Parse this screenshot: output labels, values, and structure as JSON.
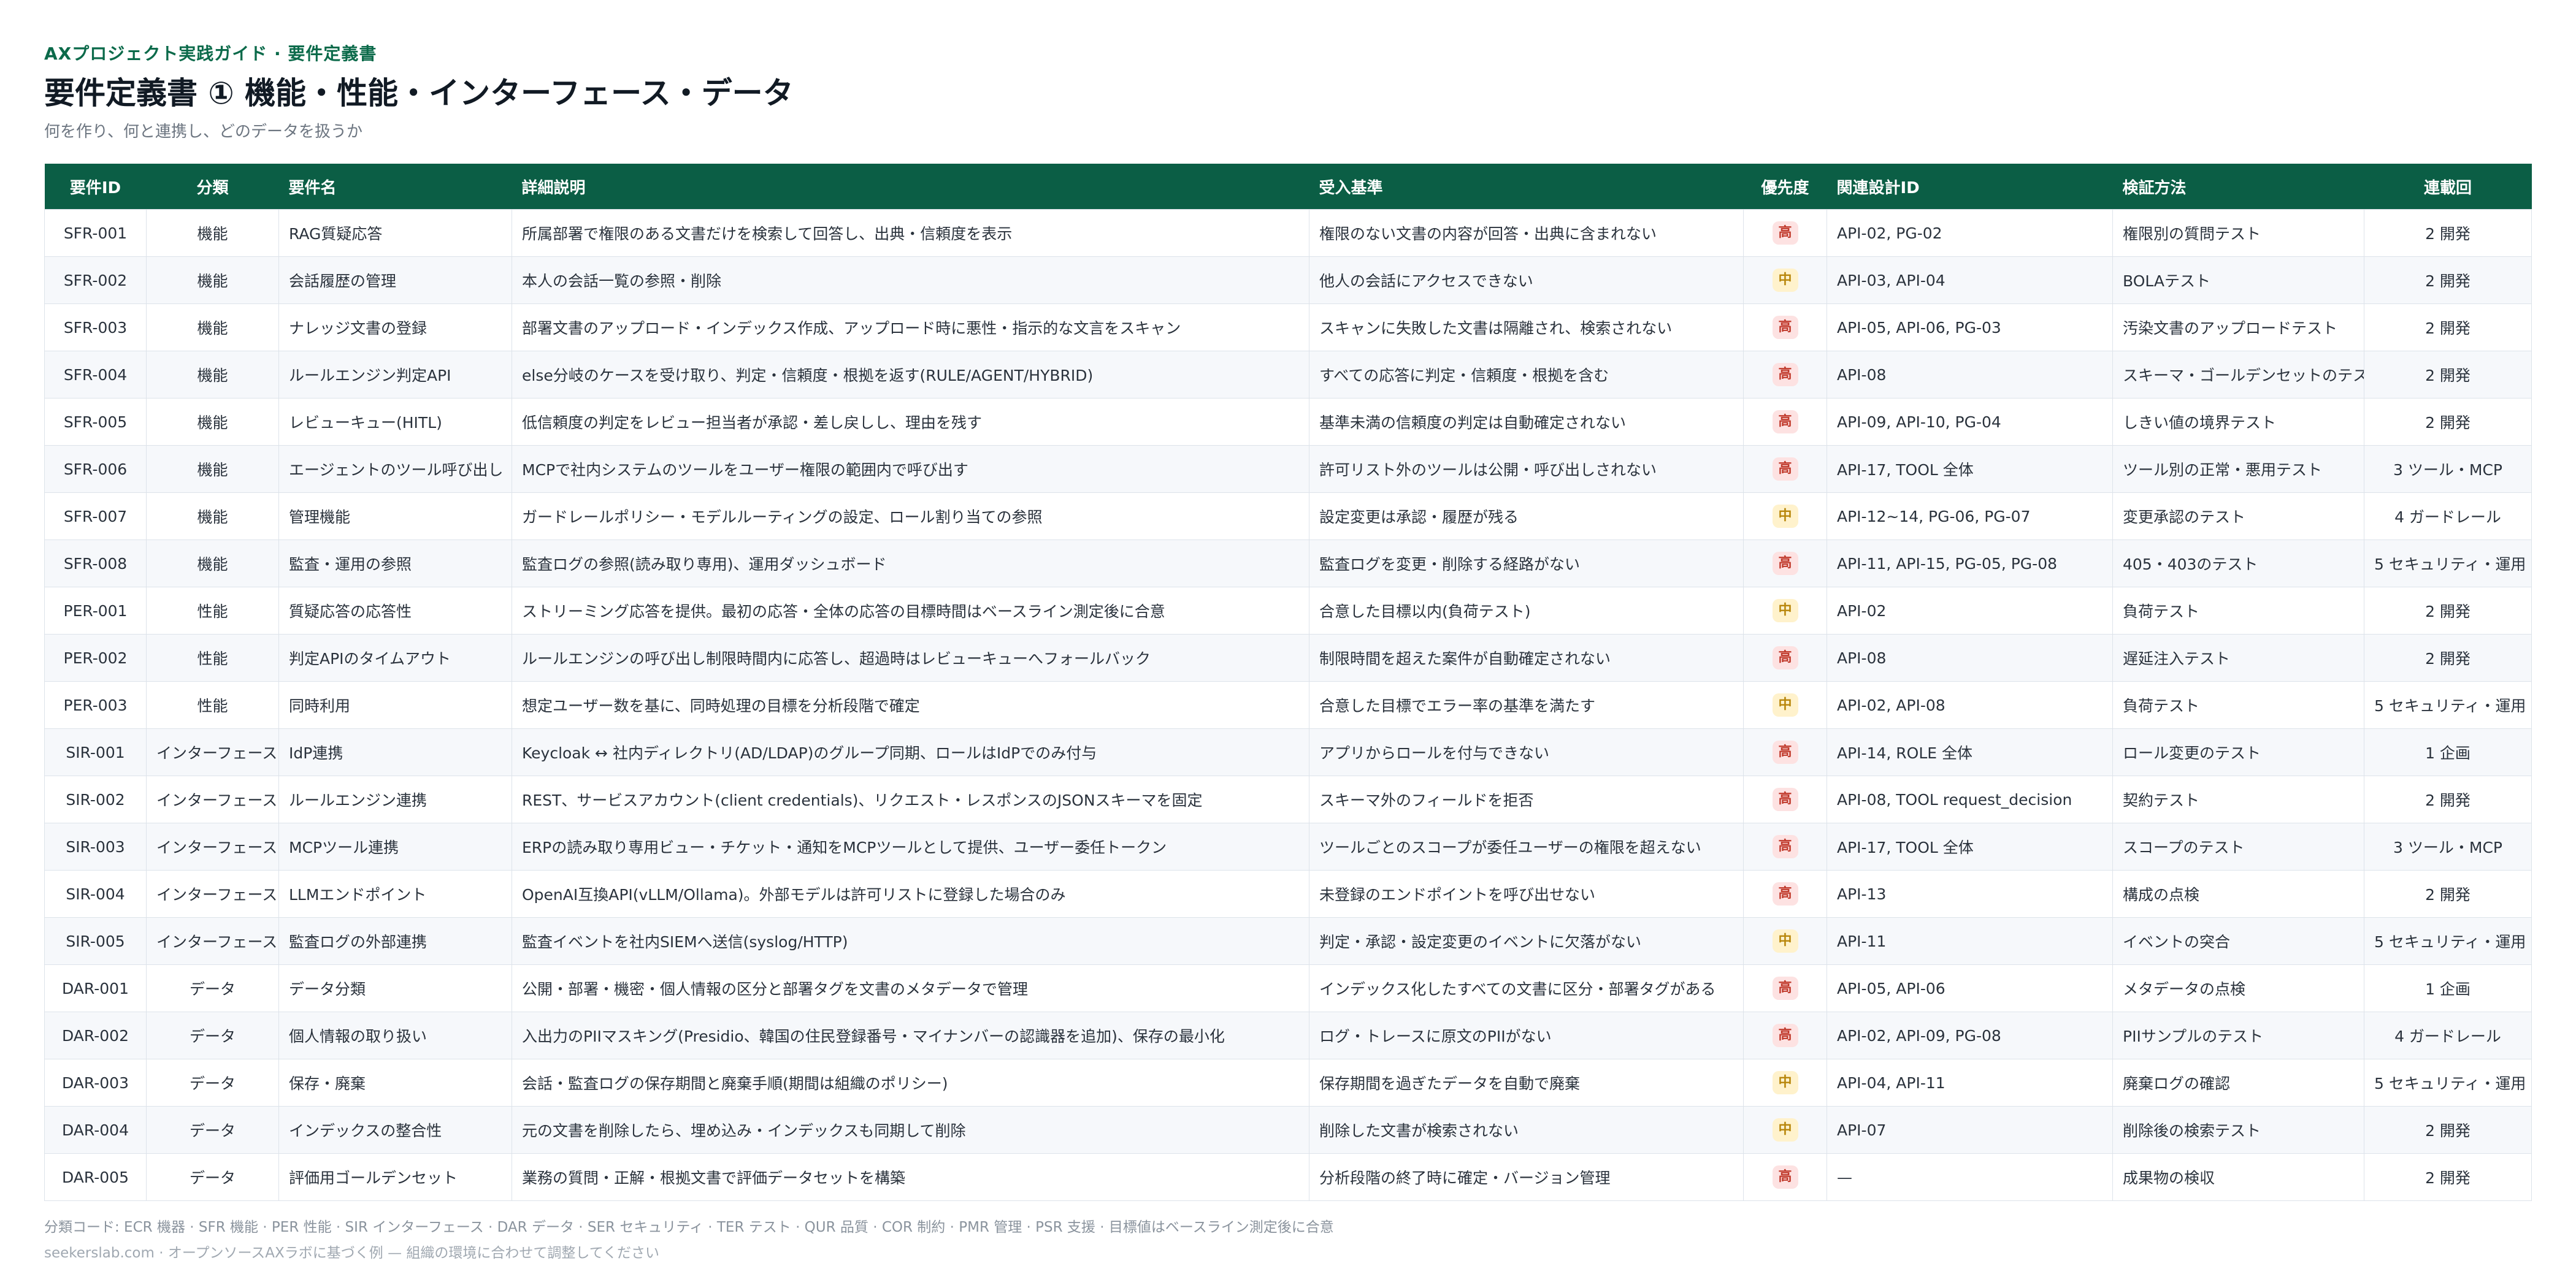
{
  "header": {
    "eyebrow": "AXプロジェクト実践ガイド · 要件定義書",
    "title": "要件定義書 ① 機能・性能・インターフェース・データ",
    "subtitle": "何を作り、何と連携し、どのデータを扱うか"
  },
  "table": {
    "columns": [
      "要件ID",
      "分類",
      "要件名",
      "詳細説明",
      "受入基準",
      "優先度",
      "関連設計ID",
      "検証方法",
      "連載回"
    ],
    "rows": [
      {
        "id": "SFR-001",
        "category": "機能",
        "name": "RAG質疑応答",
        "detail": "所属部署で権限のある文書だけを検索して回答し、出典・信頼度を表示",
        "acceptance": "権限のない文書の内容が回答・出典に含まれない",
        "priority": "高",
        "priority_level": "high",
        "design": "API-02, PG-02",
        "verify": "権限別の質問テスト",
        "episode": "2 開発"
      },
      {
        "id": "SFR-002",
        "category": "機能",
        "name": "会話履歴の管理",
        "detail": "本人の会話一覧の参照・削除",
        "acceptance": "他人の会話にアクセスできない",
        "priority": "中",
        "priority_level": "mid",
        "design": "API-03, API-04",
        "verify": "BOLAテスト",
        "episode": "2 開発"
      },
      {
        "id": "SFR-003",
        "category": "機能",
        "name": "ナレッジ文書の登録",
        "detail": "部署文書のアップロード・インデックス作成、アップロード時に悪性・指示的な文言をスキャン",
        "acceptance": "スキャンに失敗した文書は隔離され、検索されない",
        "priority": "高",
        "priority_level": "high",
        "design": "API-05, API-06, PG-03",
        "verify": "汚染文書のアップロードテスト",
        "episode": "2 開発"
      },
      {
        "id": "SFR-004",
        "category": "機能",
        "name": "ルールエンジン判定API",
        "detail": "else分岐のケースを受け取り、判定・信頼度・根拠を返す(RULE/AGENT/HYBRID)",
        "acceptance": "すべての応答に判定・信頼度・根拠を含む",
        "priority": "高",
        "priority_level": "high",
        "design": "API-08",
        "verify": "スキーマ・ゴールデンセットのテスト",
        "episode": "2 開発"
      },
      {
        "id": "SFR-005",
        "category": "機能",
        "name": "レビューキュー(HITL)",
        "detail": "低信頼度の判定をレビュー担当者が承認・差し戻しし、理由を残す",
        "acceptance": "基準未満の信頼度の判定は自動確定されない",
        "priority": "高",
        "priority_level": "high",
        "design": "API-09, API-10, PG-04",
        "verify": "しきい値の境界テスト",
        "episode": "2 開発"
      },
      {
        "id": "SFR-006",
        "category": "機能",
        "name": "エージェントのツール呼び出し",
        "detail": "MCPで社内システムのツールをユーザー権限の範囲内で呼び出す",
        "acceptance": "許可リスト外のツールは公開・呼び出しされない",
        "priority": "高",
        "priority_level": "high",
        "design": "API-17, TOOL 全体",
        "verify": "ツール別の正常・悪用テスト",
        "episode": "3 ツール・MCP"
      },
      {
        "id": "SFR-007",
        "category": "機能",
        "name": "管理機能",
        "detail": "ガードレールポリシー・モデルルーティングの設定、ロール割り当ての参照",
        "acceptance": "設定変更は承認・履歴が残る",
        "priority": "中",
        "priority_level": "mid",
        "design": "API-12~14, PG-06, PG-07",
        "verify": "変更承認のテスト",
        "episode": "4 ガードレール"
      },
      {
        "id": "SFR-008",
        "category": "機能",
        "name": "監査・運用の参照",
        "detail": "監査ログの参照(読み取り専用)、運用ダッシュボード",
        "acceptance": "監査ログを変更・削除する経路がない",
        "priority": "高",
        "priority_level": "high",
        "design": "API-11, API-15, PG-05, PG-08",
        "verify": "405・403のテスト",
        "episode": "5 セキュリティ・運用"
      },
      {
        "id": "PER-001",
        "category": "性能",
        "name": "質疑応答の応答性",
        "detail": "ストリーミング応答を提供。最初の応答・全体の応答の目標時間はベースライン測定後に合意",
        "acceptance": "合意した目標以内(負荷テスト)",
        "priority": "中",
        "priority_level": "mid",
        "design": "API-02",
        "verify": "負荷テスト",
        "episode": "2 開発"
      },
      {
        "id": "PER-002",
        "category": "性能",
        "name": "判定APIのタイムアウト",
        "detail": "ルールエンジンの呼び出し制限時間内に応答し、超過時はレビューキューへフォールバック",
        "acceptance": "制限時間を超えた案件が自動確定されない",
        "priority": "高",
        "priority_level": "high",
        "design": "API-08",
        "verify": "遅延注入テスト",
        "episode": "2 開発"
      },
      {
        "id": "PER-003",
        "category": "性能",
        "name": "同時利用",
        "detail": "想定ユーザー数を基に、同時処理の目標を分析段階で確定",
        "acceptance": "合意した目標でエラー率の基準を満たす",
        "priority": "中",
        "priority_level": "mid",
        "design": "API-02, API-08",
        "verify": "負荷テスト",
        "episode": "5 セキュリティ・運用"
      },
      {
        "id": "SIR-001",
        "category": "インターフェース",
        "name": "IdP連携",
        "detail": "Keycloak ↔ 社内ディレクトリ(AD/LDAP)のグループ同期、ロールはIdPでのみ付与",
        "acceptance": "アプリからロールを付与できない",
        "priority": "高",
        "priority_level": "high",
        "design": "API-14, ROLE 全体",
        "verify": "ロール変更のテスト",
        "episode": "1 企画"
      },
      {
        "id": "SIR-002",
        "category": "インターフェース",
        "name": "ルールエンジン連携",
        "detail": "REST、サービスアカウント(client credentials)、リクエスト・レスポンスのJSONスキーマを固定",
        "acceptance": "スキーマ外のフィールドを拒否",
        "priority": "高",
        "priority_level": "high",
        "design": "API-08, TOOL request_decision",
        "verify": "契約テスト",
        "episode": "2 開発"
      },
      {
        "id": "SIR-003",
        "category": "インターフェース",
        "name": "MCPツール連携",
        "detail": "ERPの読み取り専用ビュー・チケット・通知をMCPツールとして提供、ユーザー委任トークン",
        "acceptance": "ツールごとのスコープが委任ユーザーの権限を超えない",
        "priority": "高",
        "priority_level": "high",
        "design": "API-17, TOOL 全体",
        "verify": "スコープのテスト",
        "episode": "3 ツール・MCP"
      },
      {
        "id": "SIR-004",
        "category": "インターフェース",
        "name": "LLMエンドポイント",
        "detail": "OpenAI互換API(vLLM/Ollama)。外部モデルは許可リストに登録した場合のみ",
        "acceptance": "未登録のエンドポイントを呼び出せない",
        "priority": "高",
        "priority_level": "high",
        "design": "API-13",
        "verify": "構成の点検",
        "episode": "2 開発"
      },
      {
        "id": "SIR-005",
        "category": "インターフェース",
        "name": "監査ログの外部連携",
        "detail": "監査イベントを社内SIEMへ送信(syslog/HTTP)",
        "acceptance": "判定・承認・設定変更のイベントに欠落がない",
        "priority": "中",
        "priority_level": "mid",
        "design": "API-11",
        "verify": "イベントの突合",
        "episode": "5 セキュリティ・運用"
      },
      {
        "id": "DAR-001",
        "category": "データ",
        "name": "データ分類",
        "detail": "公開・部署・機密・個人情報の区分と部署タグを文書のメタデータで管理",
        "acceptance": "インデックス化したすべての文書に区分・部署タグがある",
        "priority": "高",
        "priority_level": "high",
        "design": "API-05, API-06",
        "verify": "メタデータの点検",
        "episode": "1 企画"
      },
      {
        "id": "DAR-002",
        "category": "データ",
        "name": "個人情報の取り扱い",
        "detail": "入出力のPIIマスキング(Presidio、韓国の住民登録番号・マイナンバーの認識器を追加)、保存の最小化",
        "acceptance": "ログ・トレースに原文のPIIがない",
        "priority": "高",
        "priority_level": "high",
        "design": "API-02, API-09, PG-08",
        "verify": "PIIサンプルのテスト",
        "episode": "4 ガードレール"
      },
      {
        "id": "DAR-003",
        "category": "データ",
        "name": "保存・廃棄",
        "detail": "会話・監査ログの保存期間と廃棄手順(期間は組織のポリシー)",
        "acceptance": "保存期間を過ぎたデータを自動で廃棄",
        "priority": "中",
        "priority_level": "mid",
        "design": "API-04, API-11",
        "verify": "廃棄ログの確認",
        "episode": "5 セキュリティ・運用"
      },
      {
        "id": "DAR-004",
        "category": "データ",
        "name": "インデックスの整合性",
        "detail": "元の文書を削除したら、埋め込み・インデックスも同期して削除",
        "acceptance": "削除した文書が検索されない",
        "priority": "中",
        "priority_level": "mid",
        "design": "API-07",
        "verify": "削除後の検索テスト",
        "episode": "2 開発"
      },
      {
        "id": "DAR-005",
        "category": "データ",
        "name": "評価用ゴールデンセット",
        "detail": "業務の質問・正解・根拠文書で評価データセットを構築",
        "acceptance": "分析段階の終了時に確定・バージョン管理",
        "priority": "高",
        "priority_level": "high",
        "design": "—",
        "verify": "成果物の検収",
        "episode": "2 開発"
      }
    ]
  },
  "footer": {
    "legend": "分類コード: ECR 機器 · SFR 機能 · PER 性能 · SIR インターフェース · DAR データ · SER セキュリティ · TER テスト · QUR 品質 · COR 制約 · PMR 管理 · PSR 支援 · 目標値はベースライン測定後に合意",
    "credit": "seekerslab.com · オープンソースAXラボに基づく例 — 組織の環境に合わせて調整してください"
  },
  "colors": {
    "header_bg": "#0b5e45",
    "eyebrow": "#0b6a4a",
    "priority_high_bg": "#fde2e2",
    "priority_high_text": "#c0392b",
    "priority_mid_bg": "#fff2cc",
    "priority_mid_text": "#b8860b"
  }
}
